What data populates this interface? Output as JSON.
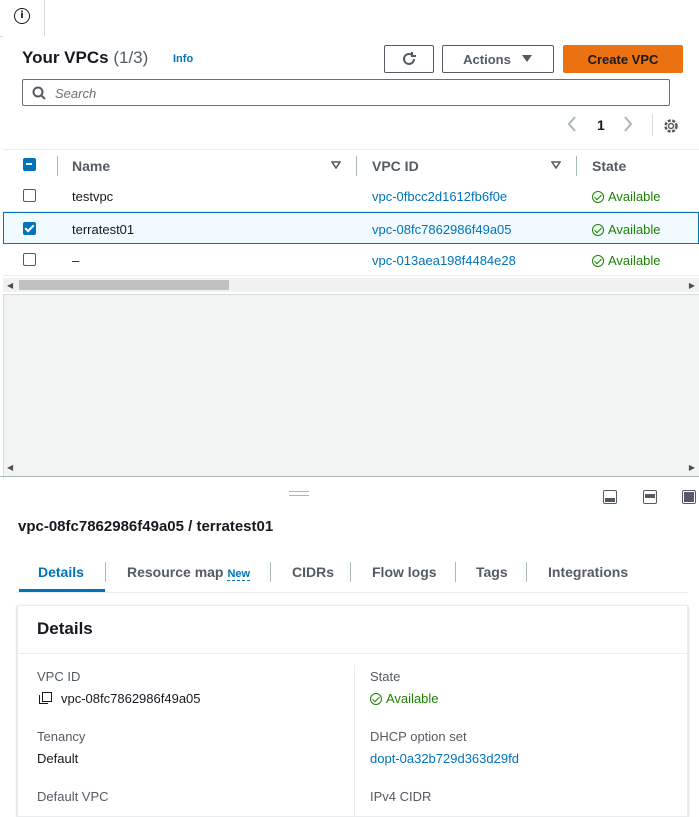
{
  "header": {
    "title": "Your VPCs",
    "count": "(1/3)",
    "info": "Info"
  },
  "toolbar": {
    "actions_label": "Actions",
    "create_label": "Create VPC"
  },
  "search": {
    "placeholder": "Search"
  },
  "pagination": {
    "page": "1"
  },
  "table": {
    "columns": [
      "Name",
      "VPC ID",
      "State"
    ],
    "rows": [
      {
        "name": "testvpc",
        "vpc_id": "vpc-0fbcc2d1612fb6f0e",
        "state": "Available",
        "selected": false
      },
      {
        "name": "terratest01",
        "vpc_id": "vpc-08fc7862986f49a05",
        "state": "Available",
        "selected": true
      },
      {
        "name": "–",
        "vpc_id": "vpc-013aea198f4484e28",
        "state": "Available",
        "selected": false
      }
    ]
  },
  "detail": {
    "title": "vpc-08fc7862986f49a05 / terratest01",
    "tabs": [
      {
        "label": "Details"
      },
      {
        "label": "Resource map",
        "badge": "New"
      },
      {
        "label": "CIDRs"
      },
      {
        "label": "Flow logs"
      },
      {
        "label": "Tags"
      },
      {
        "label": "Integrations"
      }
    ],
    "card_title": "Details",
    "fields": {
      "vpc_id_label": "VPC ID",
      "vpc_id_value": "vpc-08fc7862986f49a05",
      "state_label": "State",
      "state_value": "Available",
      "tenancy_label": "Tenancy",
      "tenancy_value": "Default",
      "dhcp_label": "DHCP option set",
      "dhcp_value": "dopt-0a32b729d363d29fd",
      "default_vpc_label": "Default VPC",
      "ipv4_label": "IPv4 CIDR"
    }
  },
  "colors": {
    "accent": "#0073bb",
    "primary_button": "#ec7211",
    "success": "#1d8102"
  }
}
